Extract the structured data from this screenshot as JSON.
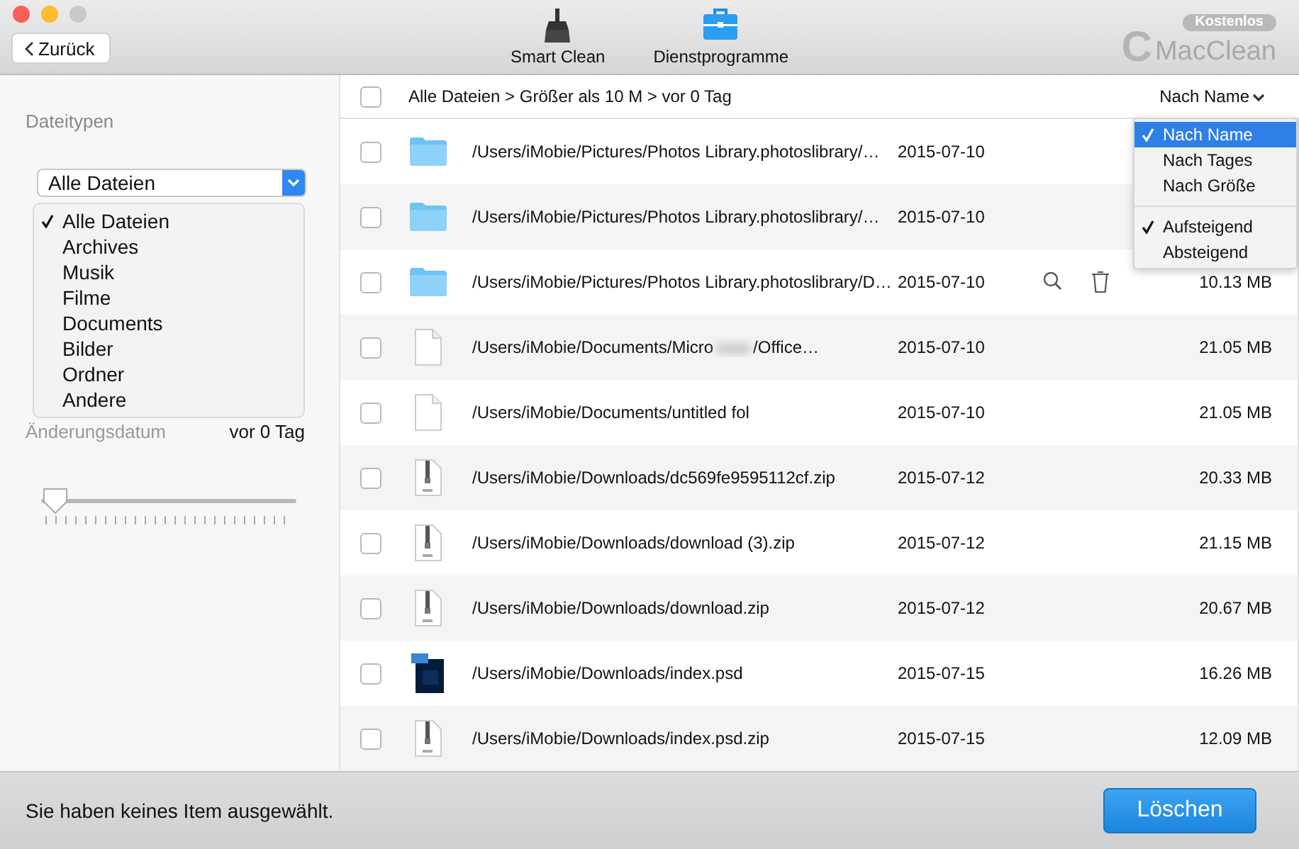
{
  "toolbar": {
    "back_button": "Zurück",
    "tools": [
      {
        "label": "Smart Clean",
        "kind": "broom"
      },
      {
        "label": "Dienstprogramme",
        "kind": "briefcase"
      }
    ],
    "badge": "Kostenlos",
    "logo_mark": "C",
    "logo_text": "MacClean"
  },
  "sidebar": {
    "title": "Dateitypen",
    "filetype_select": {
      "value": "Alle Dateien",
      "options": [
        {
          "label": "Alle Dateien",
          "selected": true
        },
        {
          "label": "Archives",
          "selected": false
        },
        {
          "label": "Musik",
          "selected": false
        },
        {
          "label": "Filme",
          "selected": false
        },
        {
          "label": "Documents",
          "selected": false
        },
        {
          "label": "Bilder",
          "selected": false
        },
        {
          "label": "Ordner",
          "selected": false
        },
        {
          "label": "Andere",
          "selected": false
        }
      ]
    },
    "date_filter": {
      "label": "Änderungsdatum",
      "value": "vor 0 Tag",
      "level": 0
    }
  },
  "list": {
    "select_all": {
      "checked": false
    },
    "breadcrumb": "Alle Dateien > Größer als 10 M > vor 0 Tag",
    "sort_button": "Nach Name",
    "sort_menu": [
      {
        "items": [
          {
            "label": "Nach Name",
            "selected": true
          },
          {
            "label": "Nach Tages",
            "selected": false
          },
          {
            "label": "Nach Größe",
            "selected": false
          }
        ]
      },
      {
        "items": [
          {
            "label": "Aufsteigend",
            "selected": true
          },
          {
            "label": "Absteigend",
            "selected": false
          }
        ]
      }
    ],
    "rows": [
      {
        "kind": "folder",
        "path": "/Users/iMobie/Pictures/Photos Library.photoslibrary/…",
        "date": "2015-07-10",
        "checked": false,
        "hover": false
      },
      {
        "kind": "folder",
        "path": "/Users/iMobie/Pictures/Photos Library.photoslibrary/…",
        "date": "2015-07-10",
        "checked": false,
        "hover": false
      },
      {
        "kind": "folder",
        "path": "/Users/iMobie/Pictures/Photos Library.photoslibrary/D…",
        "date": "2015-07-10",
        "size": "10.13 MB",
        "checked": false,
        "hover": true
      },
      {
        "kind": "document",
        "path": "/Users/iMobie/Documents/Micro",
        "path_after_blur": "/Office…",
        "date": "2015-07-10",
        "size": "21.05 MB",
        "checked": false,
        "hover": false
      },
      {
        "kind": "document",
        "path": "/Users/iMobie/Documents/untitled fol",
        "date": "2015-07-10",
        "size": "21.05 MB",
        "checked": false,
        "hover": false
      },
      {
        "kind": "zip",
        "path": "/Users/iMobie/Downloads/dc569fe9595112cf.zip",
        "date": "2015-07-12",
        "size": "20.33 MB",
        "checked": false,
        "hover": false
      },
      {
        "kind": "zip",
        "path": "/Users/iMobie/Downloads/download (3).zip",
        "date": "2015-07-12",
        "size": "21.15 MB",
        "checked": false,
        "hover": false
      },
      {
        "kind": "zip",
        "path": "/Users/iMobie/Downloads/download.zip",
        "date": "2015-07-12",
        "size": "20.67 MB",
        "checked": false,
        "hover": false
      },
      {
        "kind": "psd",
        "path": "/Users/iMobie/Downloads/index.psd",
        "date": "2015-07-15",
        "size": "16.26 MB",
        "checked": false,
        "hover": false
      },
      {
        "kind": "zip",
        "path": "/Users/iMobie/Downloads/index.psd.zip",
        "date": "2015-07-15",
        "size": "12.09 MB",
        "checked": false,
        "hover": false
      }
    ]
  },
  "status_bar": {
    "message": "Sie haben keines Item ausgewählt.",
    "delete_button": "Löschen"
  }
}
